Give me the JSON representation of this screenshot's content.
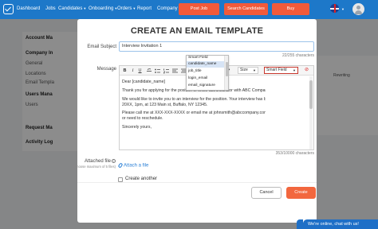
{
  "nav": {
    "items": [
      {
        "label": "Dashboard",
        "caret": false
      },
      {
        "label": "Jobs",
        "caret": false
      },
      {
        "label": "Candidates",
        "caret": true
      },
      {
        "label": "Onboarding",
        "caret": true
      },
      {
        "label": "Orders",
        "caret": true
      },
      {
        "label": "Report",
        "caret": false
      },
      {
        "label": "Company",
        "caret": false
      }
    ],
    "post_job": "Post Job",
    "search_candidates": "Search Candidates",
    "buy": "Buy",
    "caret_glyph": "▼"
  },
  "background": {
    "sidebar": {
      "account_header": "Account Ma",
      "company_header": "Company In",
      "items": [
        "General",
        "Locations",
        "Email Templa"
      ],
      "users_header": "Users Mana",
      "users_items": [
        "Users"
      ],
      "request_header": "Request Ma",
      "activity_header": "Activity Log"
    },
    "right_text": "Rewriting"
  },
  "modal": {
    "title": "CREATE AN EMAIL TEMPLATE",
    "subject_label": "Email Subject",
    "subject_value": "Interview Invitation 1",
    "subject_counter": "22/255 characters",
    "message_label": "Message",
    "toolbar": {
      "bold": "B",
      "italic": "I",
      "underline": "U",
      "size_label": "Size",
      "smart_field_label": "Smart Field",
      "dropdown_glyph": "▼",
      "reset_glyph": "⊘"
    },
    "smart_field_options": [
      "Smart Field",
      "candidate_name",
      "job_title",
      "login_email",
      "email_signature"
    ],
    "smart_field_selected": "candidate_name",
    "message_body": [
      "Dear [candidate_name]",
      "Thank you for applying for the position of office administrator with ABC Company.",
      "We would like to invite you to an interview for the position. Your interview has bee",
      "20XX, 1pm, at 123 Main st, Buffalo, NY 12345.",
      "Please call me at XXX-XXX-XXXX or email me at johnsmith@abccompany.com if you have any questions",
      "or need to reschedule.",
      "Sincerely yours,"
    ],
    "message_counter": "353/10000 characters",
    "attached_label": "Attached file",
    "attached_sub": "(Choose maximum of 5 files)",
    "info_glyph": "i",
    "attach_link": "Attach a file",
    "create_another": "Create another",
    "cancel": "Cancel",
    "create": "Create"
  },
  "chat": "We're online, chat with us!"
}
